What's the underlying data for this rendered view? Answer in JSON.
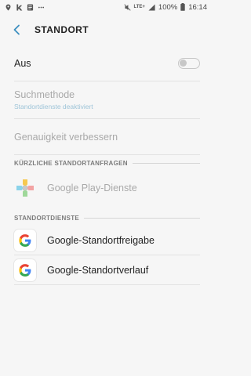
{
  "status_bar": {
    "battery": "100%",
    "time": "16:14",
    "network": "LTE+"
  },
  "appbar": {
    "title": "STANDORT",
    "back_icon": "back-arrow-icon"
  },
  "location_toggle": {
    "label": "Aus",
    "state": "off"
  },
  "search_method": {
    "label": "Suchmethode",
    "subtitle": "Standortdienste deaktiviert"
  },
  "accuracy": {
    "label": "Genauigkeit verbessern"
  },
  "recent_requests": {
    "header": "KÜRZLICHE STANDORTANFRAGEN",
    "items": [
      {
        "label": "Google Play-Dienste",
        "icon": "google-play-services-icon"
      }
    ]
  },
  "location_services": {
    "header": "STANDORTDIENSTE",
    "items": [
      {
        "label": "Google-Standortfreigabe",
        "icon": "google-icon"
      },
      {
        "label": "Google-Standortverlauf",
        "icon": "google-icon"
      }
    ]
  },
  "colors": {
    "accent": "#3c8fc0",
    "disabled_text": "#a9a9a9",
    "background": "#f6f6f6"
  }
}
